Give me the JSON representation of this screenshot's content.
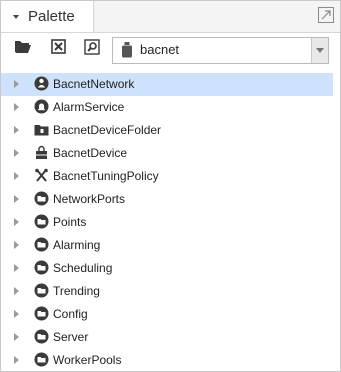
{
  "palette": {
    "title": "Palette"
  },
  "toolbar": {
    "module_selector_value": "bacnet"
  },
  "tree": {
    "items": [
      {
        "label": "BacnetNetwork",
        "icon": "network-icon",
        "selected": true
      },
      {
        "label": "AlarmService",
        "icon": "bell-icon",
        "selected": false
      },
      {
        "label": "BacnetDeviceFolder",
        "icon": "device-folder-icon",
        "selected": false
      },
      {
        "label": "BacnetDevice",
        "icon": "device-icon",
        "selected": false
      },
      {
        "label": "BacnetTuningPolicy",
        "icon": "tools-icon",
        "selected": false
      },
      {
        "label": "NetworkPorts",
        "icon": "folder-icon",
        "selected": false
      },
      {
        "label": "Points",
        "icon": "folder-icon",
        "selected": false
      },
      {
        "label": "Alarming",
        "icon": "folder-icon",
        "selected": false
      },
      {
        "label": "Scheduling",
        "icon": "folder-icon",
        "selected": false
      },
      {
        "label": "Trending",
        "icon": "folder-icon",
        "selected": false
      },
      {
        "label": "Config",
        "icon": "folder-icon",
        "selected": false
      },
      {
        "label": "Server",
        "icon": "folder-icon",
        "selected": false
      },
      {
        "label": "WorkerPools",
        "icon": "folder-icon",
        "selected": false
      }
    ]
  },
  "colors": {
    "selection": "#cfe2fb",
    "icon_dark": "#3a3a3a"
  }
}
